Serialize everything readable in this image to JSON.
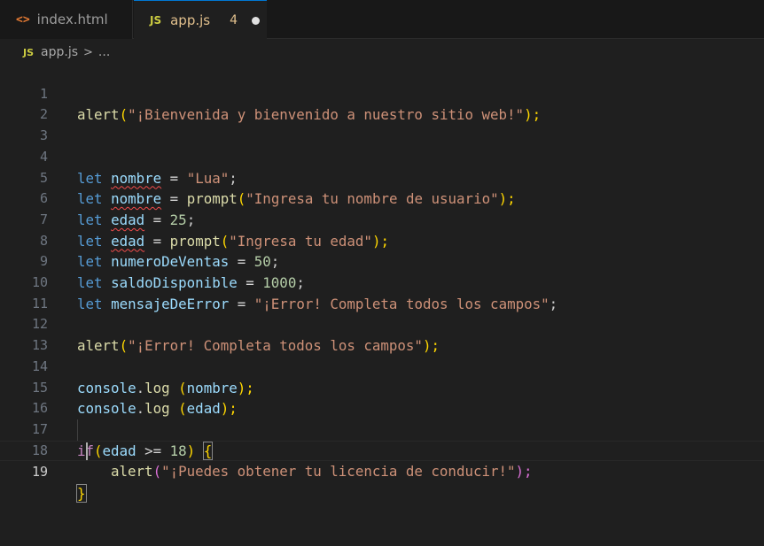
{
  "tabs": [
    {
      "icon": "html-icon",
      "icon_glyph": "<>",
      "label": "index.html"
    },
    {
      "icon": "js-icon",
      "icon_glyph": "JS",
      "label": "app.js",
      "problems": "4"
    }
  ],
  "breadcrumb": {
    "icon_glyph": "JS",
    "file": "app.js",
    "separator": ">",
    "more": "..."
  },
  "colors": {
    "keyword": "#569cd6",
    "control": "#c586c0",
    "function": "#dcdcaa",
    "string": "#ce9178",
    "number": "#b5cea8",
    "variable": "#9cdcfe",
    "error_squiggle": "#f14c4c",
    "modified_tab": "#e2c08d"
  },
  "lines": {
    "l1": {
      "n": "1",
      "fn": "alert",
      "p1": "(",
      "s": "\"¡Bienvenida y bienvenido a nuestro sitio web!\"",
      "p2": ");"
    },
    "l2": {
      "n": "2"
    },
    "l3": {
      "n": "3"
    },
    "l4": {
      "n": "4",
      "kw": "let",
      "v": "nombre",
      "op": " = ",
      "s": "\"Lua\"",
      "end": ";"
    },
    "l5": {
      "n": "5",
      "kw": "let",
      "v": "nombre",
      "op": " = ",
      "fn": "prompt",
      "p1": "(",
      "s": "\"Ingresa tu nombre de usuario\"",
      "p2": ");"
    },
    "l6": {
      "n": "6",
      "kw": "let",
      "v": "edad",
      "op": " = ",
      "num": "25",
      "end": ";"
    },
    "l7": {
      "n": "7",
      "kw": "let",
      "v": "edad",
      "op": " = ",
      "fn": "prompt",
      "p1": "(",
      "s": "\"Ingresa tu edad\"",
      "p2": ");"
    },
    "l8": {
      "n": "8",
      "kw": "let",
      "v": "numeroDeVentas",
      "op": " = ",
      "num": "50",
      "end": ";"
    },
    "l9": {
      "n": "9",
      "kw": "let",
      "v": "saldoDisponible",
      "op": " = ",
      "num": "1000",
      "end": ";"
    },
    "l10": {
      "n": "10",
      "kw": "let",
      "v": "mensajeDeError",
      "op": " = ",
      "s": "\"¡Error! Completa todos los campos\"",
      "end": ";"
    },
    "l11": {
      "n": "11"
    },
    "l12": {
      "n": "12",
      "fn": "alert",
      "p1": "(",
      "s": "\"¡Error! Completa todos los campos\"",
      "p2": ");"
    },
    "l13": {
      "n": "13"
    },
    "l14": {
      "n": "14",
      "obj": "console",
      "dot": ".",
      "fn": "log",
      "sp": " ",
      "p1": "(",
      "v": "nombre",
      "p2": ");"
    },
    "l15": {
      "n": "15",
      "obj": "console",
      "dot": ".",
      "fn": "log",
      "sp": " ",
      "p1": "(",
      "v": "edad",
      "p2": ");"
    },
    "l16": {
      "n": "16"
    },
    "l17": {
      "n": "17",
      "kw": "if",
      "p1": "(",
      "v": "edad",
      "op": " >= ",
      "num": "18",
      "p2": ") ",
      "br": "{"
    },
    "l18": {
      "n": "18",
      "fn": "alert",
      "p1": "(",
      "s": "\"¡Puedes obtener tu licencia de conducir!\"",
      "p2": ");"
    },
    "l19": {
      "n": "19",
      "br": "}"
    }
  }
}
